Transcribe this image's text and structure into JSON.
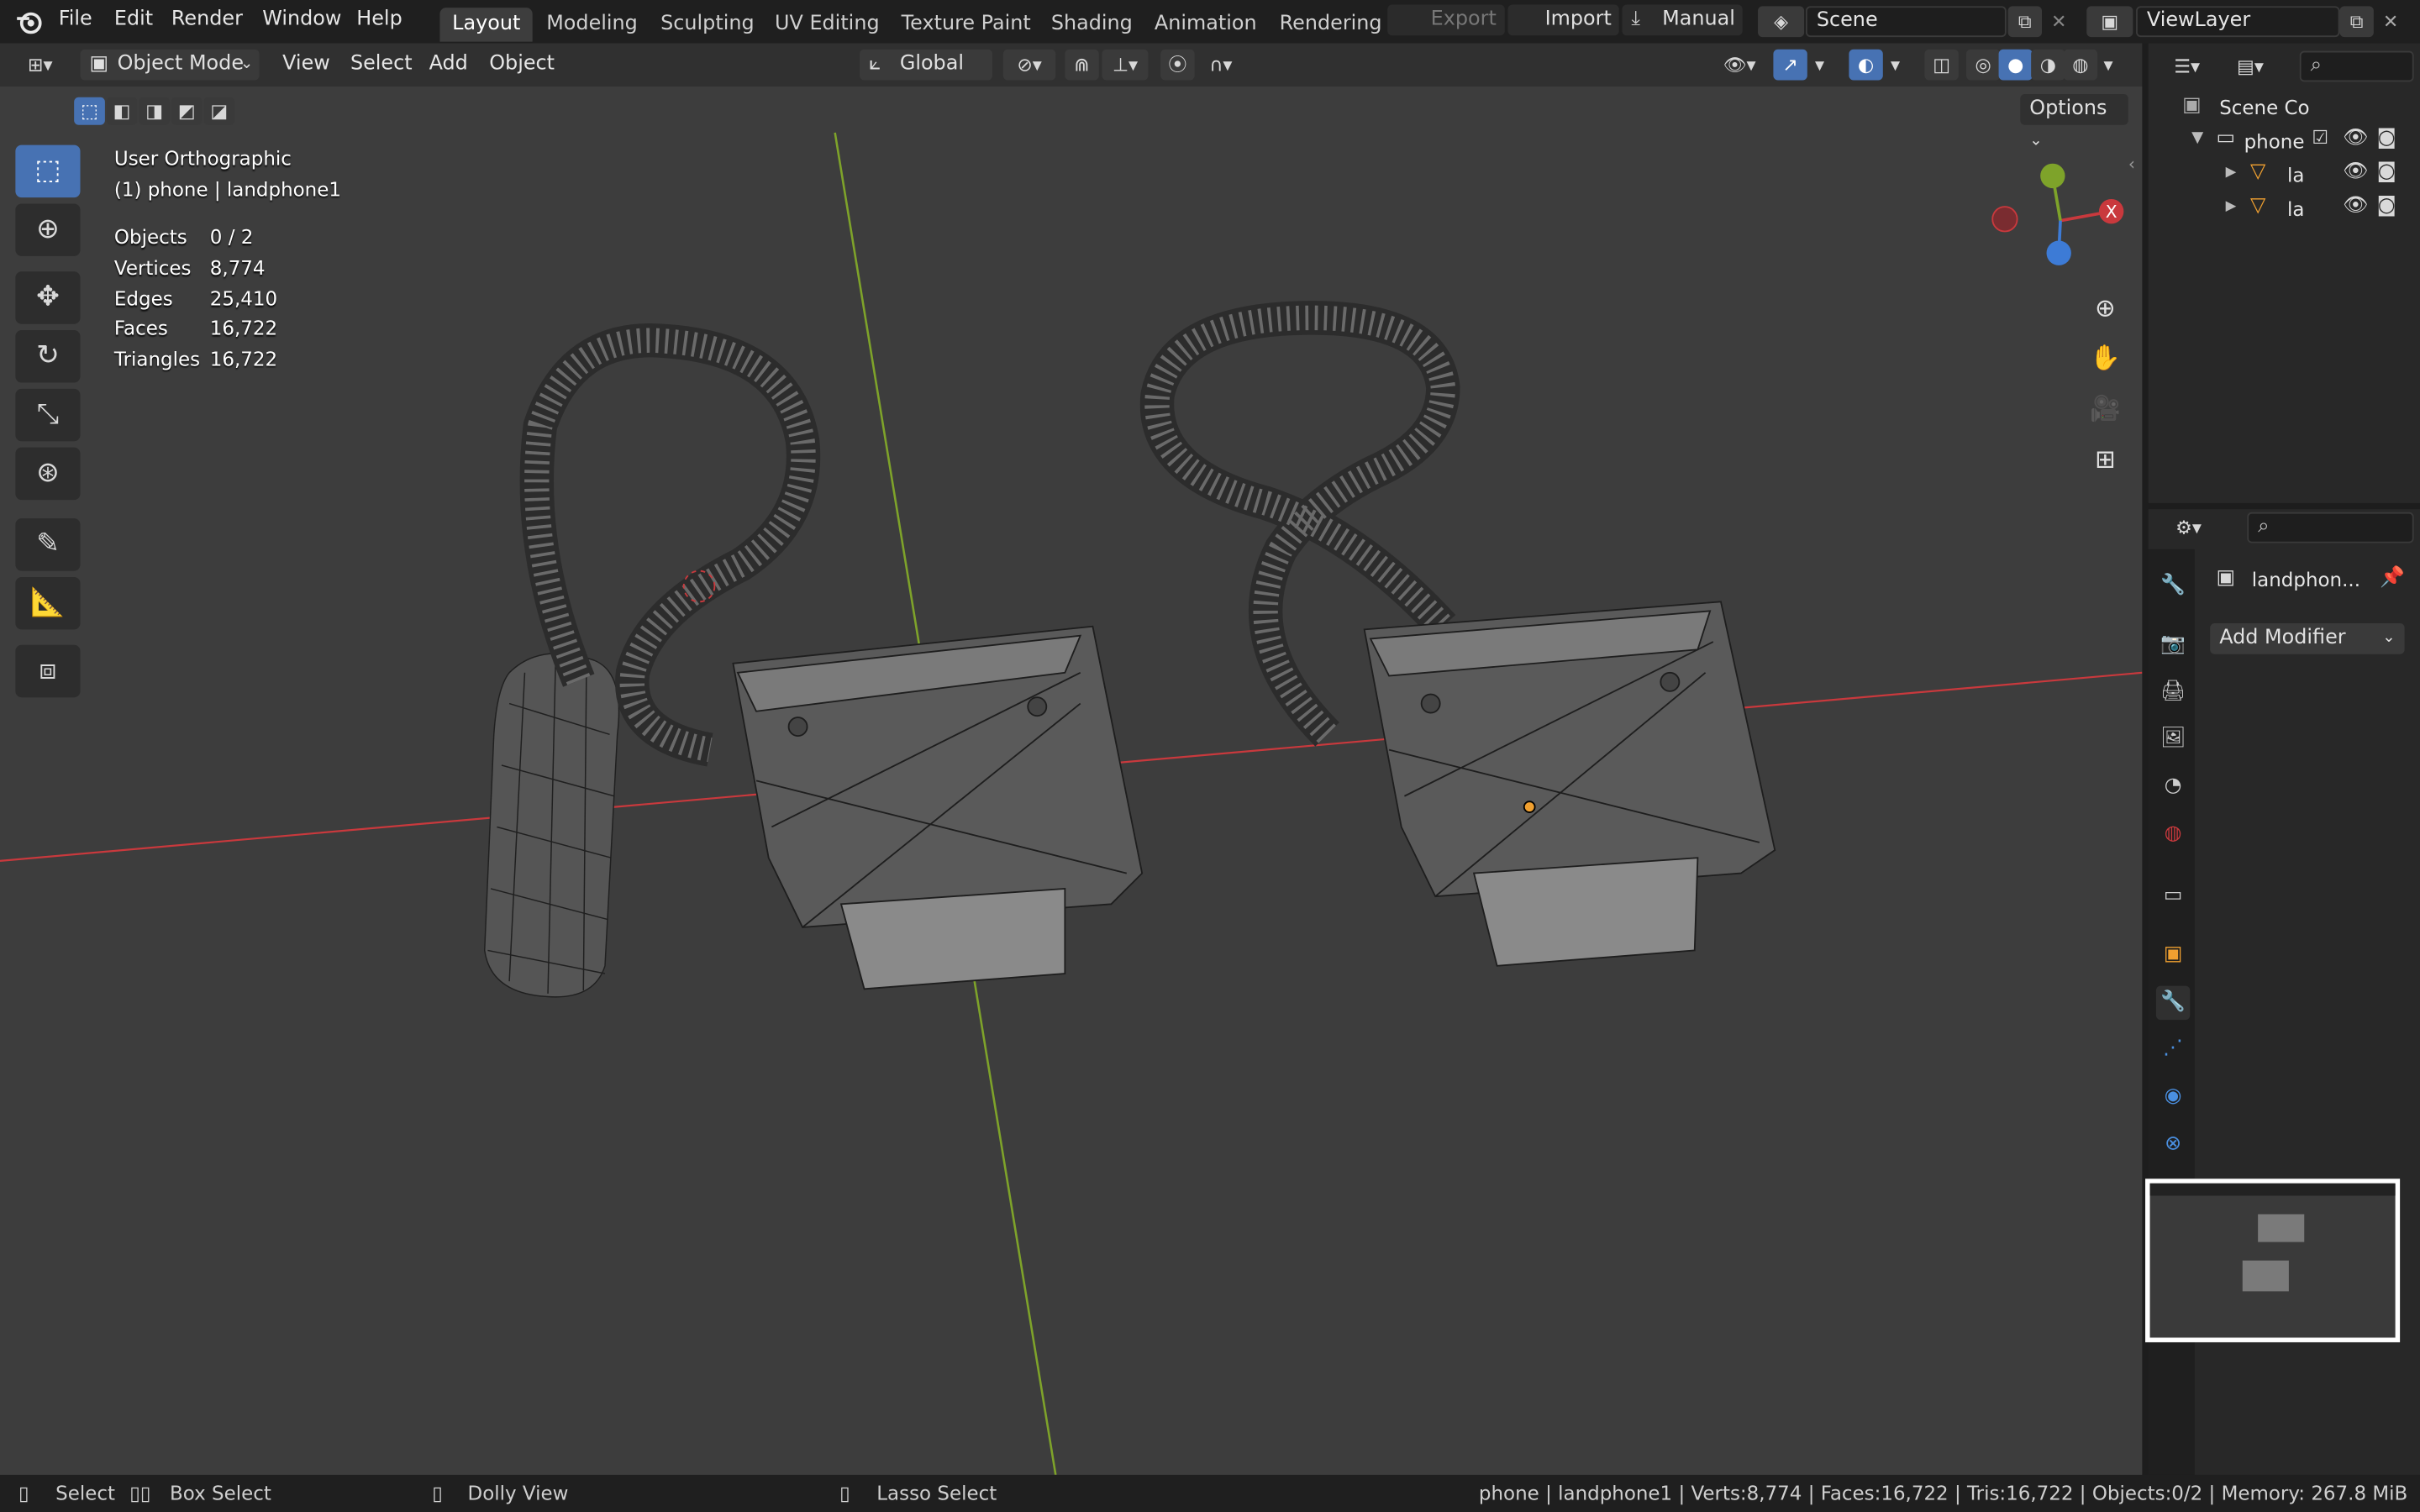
{
  "menus": [
    "File",
    "Edit",
    "Render",
    "Window",
    "Help"
  ],
  "workspaces": [
    "Layout",
    "Modeling",
    "Sculpting",
    "UV Editing",
    "Texture Paint",
    "Shading",
    "Animation",
    "Rendering"
  ],
  "active_workspace": "Layout",
  "topbar": {
    "export_label": "Export",
    "import_label": "Import",
    "manual_label": "Manual",
    "scene_name": "Scene",
    "view_layer": "ViewLayer"
  },
  "viewport_header": {
    "mode": "Object Mode",
    "menus": [
      "View",
      "Select",
      "Add",
      "Object"
    ],
    "orientation": "Global",
    "options_label": "Options"
  },
  "overlay": {
    "view_name": "User Orthographic",
    "context": "(1) phone | landphone1",
    "stats": [
      {
        "label": "Objects",
        "value": "0 / 2"
      },
      {
        "label": "Vertices",
        "value": "8,774"
      },
      {
        "label": "Edges",
        "value": "25,410"
      },
      {
        "label": "Faces",
        "value": "16,722"
      },
      {
        "label": "Triangles",
        "value": "16,722"
      }
    ]
  },
  "gizmo": {
    "x_label": "X"
  },
  "outliner": {
    "root": "Scene Co",
    "collection": "phone",
    "objects": [
      "la",
      "la"
    ]
  },
  "properties": {
    "object_name": "landphon...",
    "add_modifier": "Add Modifier"
  },
  "statusbar": {
    "select": "Select",
    "box_select": "Box Select",
    "dolly_view": "Dolly View",
    "lasso_select": "Lasso Select",
    "info": "phone | landphone1 | Verts:8,774 | Faces:16,722 | Tris:16,722 | Objects:0/2 | Memory: 267.8 MiB"
  },
  "colors": {
    "accent": "#4772b3",
    "x_axis": "#c9393d",
    "y_axis": "#7ea32a",
    "origin": "#f0a030"
  }
}
